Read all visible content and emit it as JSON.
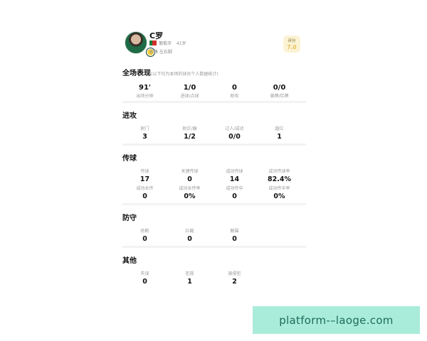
{
  "player": {
    "name": "C罗",
    "country": "葡萄牙",
    "age": "41岁",
    "role": "前锋 左右脚",
    "rating_label": "评分",
    "rating_value": "7.0"
  },
  "overall": {
    "title": "全场表现",
    "note": "(以下均为本场的球员个人数据统计)",
    "stats": [
      {
        "value": "91'",
        "label": "出场分钟"
      },
      {
        "value": "1/0",
        "label": "进球/点球"
      },
      {
        "value": "0",
        "label": "助攻"
      },
      {
        "value": "0/0",
        "label": "黄牌/红牌"
      }
    ]
  },
  "attack": {
    "title": "进攻",
    "stats": [
      {
        "label": "射门",
        "value": "3"
      },
      {
        "label": "射正/偏",
        "value": "1/2"
      },
      {
        "label": "过人/成功",
        "value": "0/0"
      },
      {
        "label": "越位",
        "value": "1"
      }
    ]
  },
  "passing": {
    "title": "传球",
    "row1": [
      {
        "label": "传球",
        "value": "17"
      },
      {
        "label": "关键传球",
        "value": "0"
      },
      {
        "label": "成功传球",
        "value": "14"
      },
      {
        "label": "成功传球率",
        "value": "82.4%"
      }
    ],
    "row2": [
      {
        "label": "成功长传",
        "value": "0"
      },
      {
        "label": "成功长传率",
        "value": "0%"
      },
      {
        "label": "成功传中",
        "value": "0"
      },
      {
        "label": "成功传中率",
        "value": "0%"
      }
    ]
  },
  "defense": {
    "title": "防守",
    "stats": [
      {
        "label": "抢断",
        "value": "0"
      },
      {
        "label": "拦截",
        "value": "0"
      },
      {
        "label": "解围",
        "value": "0"
      }
    ]
  },
  "other": {
    "title": "其他",
    "stats": [
      {
        "label": "失误",
        "value": "0"
      },
      {
        "label": "犯规",
        "value": "1"
      },
      {
        "label": "被侵犯",
        "value": "2"
      }
    ]
  },
  "watermark": "platform-–laoge.com",
  "colors": {
    "accent": "#e8c05a",
    "rating_bg": "#fbf3d3",
    "watermark_bg": "#a9ecd9"
  },
  "icons": [
    "player-avatar",
    "club-badge-icon",
    "portugal-flag-icon"
  ]
}
